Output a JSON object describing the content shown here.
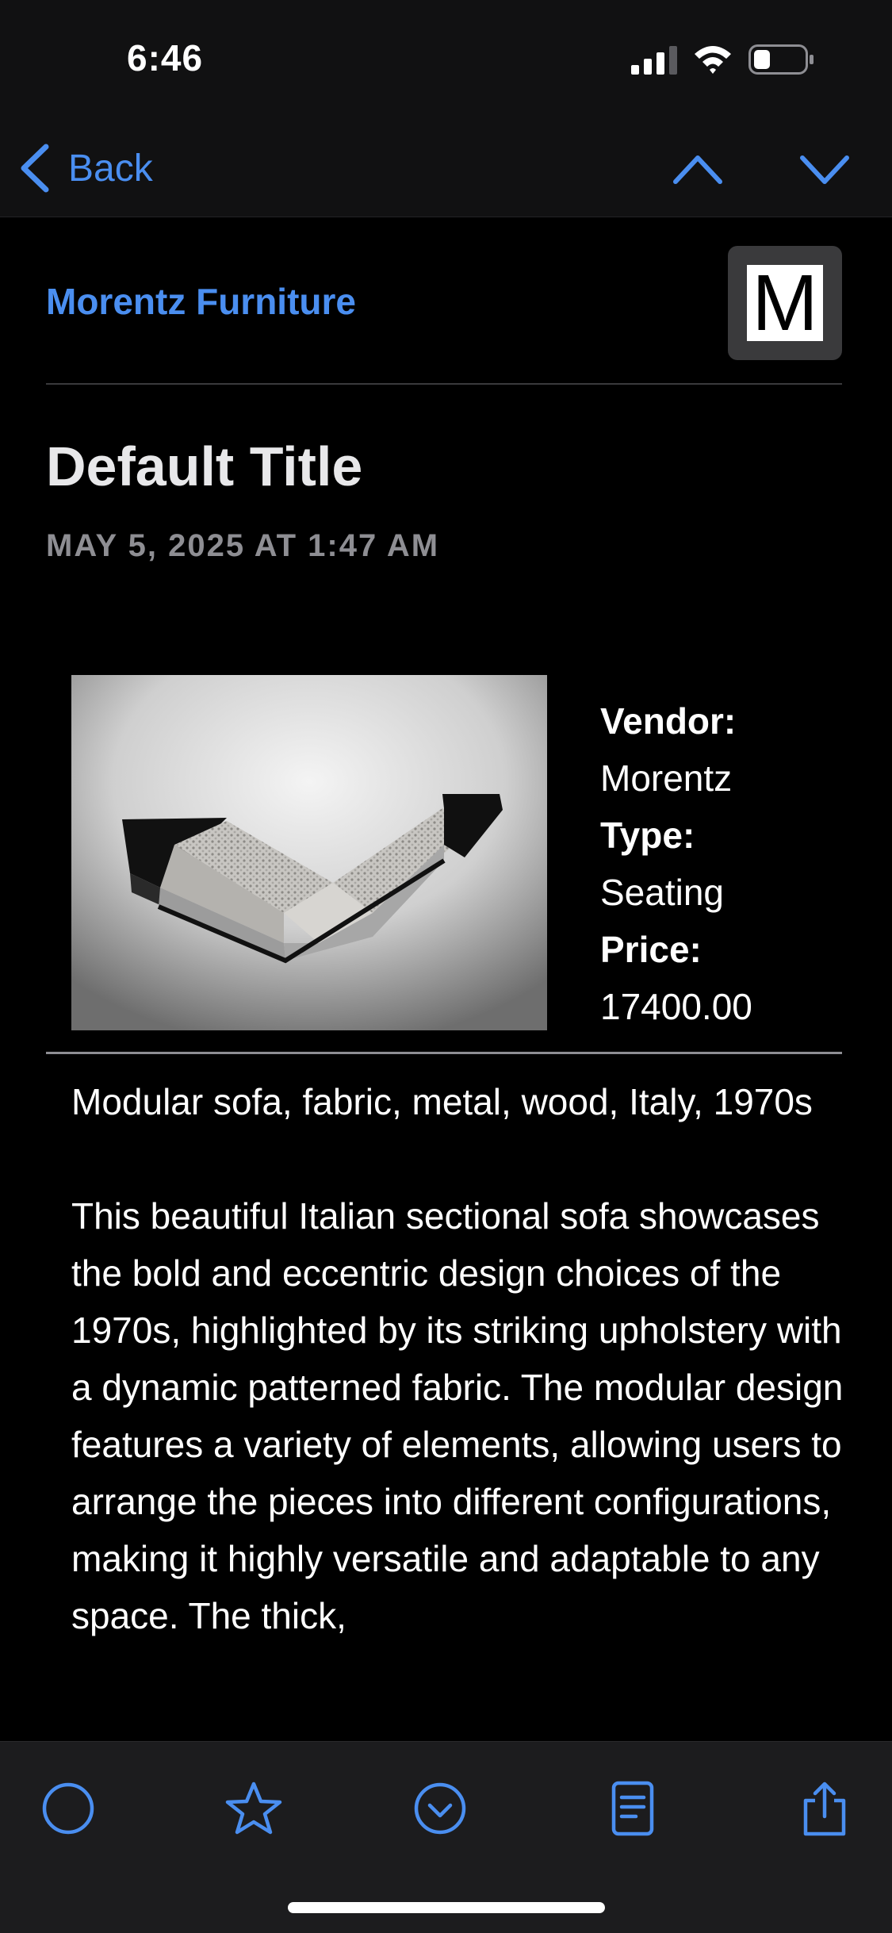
{
  "status_bar": {
    "time": "6:46"
  },
  "nav": {
    "back_label": "Back"
  },
  "header": {
    "vendor": "Morentz Furniture",
    "logo_letter": "M"
  },
  "post": {
    "title": "Default Title",
    "date": "MAY 5, 2025 AT 1:47 AM"
  },
  "specs": [
    {
      "key": "Vendor:",
      "value": "Morentz"
    },
    {
      "key": "Type:",
      "value": "Seating"
    },
    {
      "key": "Price:",
      "value": "17400.00"
    }
  ],
  "body": {
    "headline": "Modular sofa, fabric, metal, wood, Italy, 1970s",
    "paragraph": "This beautiful Italian sectional sofa showcases the bold and eccentric design choices of the 1970s, highlighted by its striking upholstery with a dynamic patterned fabric. The modular design features a variety of elements, allowing users to arrange the pieces into different configurations, making it highly versatile and adaptable to any space. The thick,"
  },
  "toolbar": {
    "icons": [
      "circle-icon",
      "star-icon",
      "checkmark-circle-icon",
      "document-icon",
      "share-icon"
    ]
  },
  "colors": {
    "accent": "#4a8ef0",
    "background": "#000000",
    "bar": "#111112"
  }
}
